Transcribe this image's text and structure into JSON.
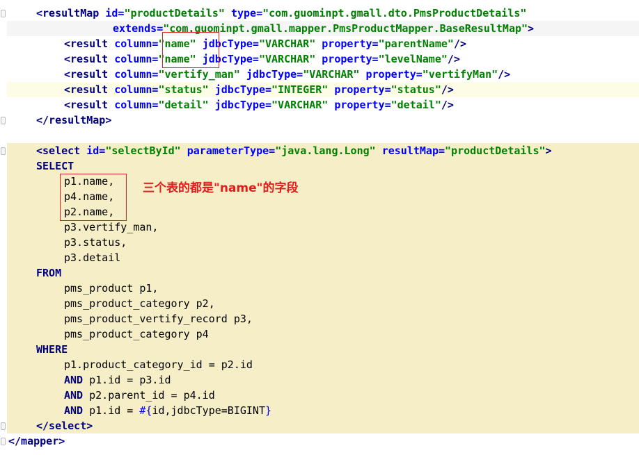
{
  "editor": {
    "resultMap": {
      "open_tag": "<resultMap",
      "id_attr": "id=",
      "id_val": "\"productDetails\"",
      "type_attr": "type=",
      "type_val": "\"com.guominpt.gmall.dto.PmsProductDetails\"",
      "extends_attr": "extends=",
      "extends_val": "\"com.guominpt.gmall.mapper.PmsProductMapper.BaseResultMap\"",
      "close_bracket": ">",
      "close_tag": "</resultMap>"
    },
    "results": [
      {
        "column": "\"name\"",
        "jdbcType": "\"VARCHAR\"",
        "property": "\"parentName\""
      },
      {
        "column": "\"name\"",
        "jdbcType": "\"VARCHAR\"",
        "property": "\"levelName\""
      },
      {
        "column": "\"vertify_man\"",
        "jdbcType": "\"VARCHAR\"",
        "property": "\"vertifyMan\""
      },
      {
        "column": "\"status\"",
        "jdbcType": "\"INTEGER\"",
        "property": "\"status\""
      },
      {
        "column": "\"detail\"",
        "jdbcType": "\"VARCHAR\"",
        "property": "\"detail\""
      }
    ],
    "result_tag": "<result",
    "column_attr": "column=",
    "jdbc_attr": "jdbcType=",
    "property_attr": "property=",
    "self_close": "/>",
    "select": {
      "open_tag": "<select",
      "id_attr": "id=",
      "id_val": "\"selectById\"",
      "param_attr": "parameterType=",
      "param_val": "\"java.lang.Long\"",
      "resultMap_attr": "resultMap=",
      "resultMap_val": "\"productDetails\"",
      "close_bracket": ">",
      "close_tag": "</select>",
      "kw_select": "SELECT",
      "kw_from": "FROM",
      "kw_where": "WHERE",
      "kw_and": "AND",
      "columns": [
        "p1.name,",
        "p4.name,",
        "p2.name,",
        "p3.vertify_man,",
        "p3.status,",
        "p3.detail"
      ],
      "tables": [
        "pms_product p1,",
        "pms_product_category p2,",
        "pms_product_vertify_record p3,",
        "pms_product_category p4"
      ],
      "where_first": "p1.product_category_id = p2.id",
      "and_conditions": [
        " p1.id = p3.id",
        " p2.parent_id = p4.id",
        " p1.id = "
      ],
      "param_open": "#{",
      "param_body": "id,jdbcType=BIGINT",
      "param_close": "}"
    },
    "mapper_close": "</mapper>"
  },
  "annotation": "三个表的都是\"name\"的字段",
  "colors": {
    "annotation": "#e31c1c",
    "box": "#e02020",
    "highlight": "#f5eec6"
  }
}
